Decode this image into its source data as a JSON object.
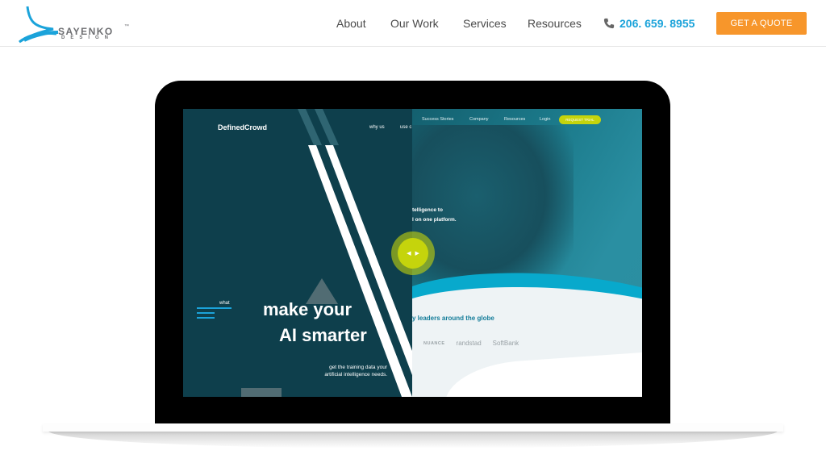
{
  "header": {
    "logo": {
      "name": "SAYENKO",
      "tm": "™",
      "sub": "DESIGN"
    },
    "nav": [
      "About",
      "Our Work",
      "Services",
      "Resources"
    ],
    "phone": "206. 659. 8955",
    "cta": "GET A QUOTE",
    "colors": {
      "accent": "#1ba3da",
      "cta": "#f7962b"
    }
  },
  "showcase": {
    "before": {
      "brand": "DefinedCrowd",
      "nav": [
        "why us",
        "use c"
      ],
      "menu_label": "what",
      "headline_line1": "make your",
      "headline_line2": "AI smarter",
      "subline": "get the training data your artificial intelligence needs."
    },
    "after": {
      "nav": [
        "Success Stories",
        "Company",
        "Resources",
        "Login"
      ],
      "cta": "REQUEST TRIAL",
      "hero_line1": "telligence to",
      "hero_line2": "l on one platform.",
      "leaders": "y leaders around the globe",
      "client_logos": [
        "NUANCE",
        "randstad",
        "SoftBank"
      ]
    },
    "slider": {
      "left_arrow": "◀",
      "right_arrow": "▶",
      "color": "#c5d40c"
    }
  }
}
